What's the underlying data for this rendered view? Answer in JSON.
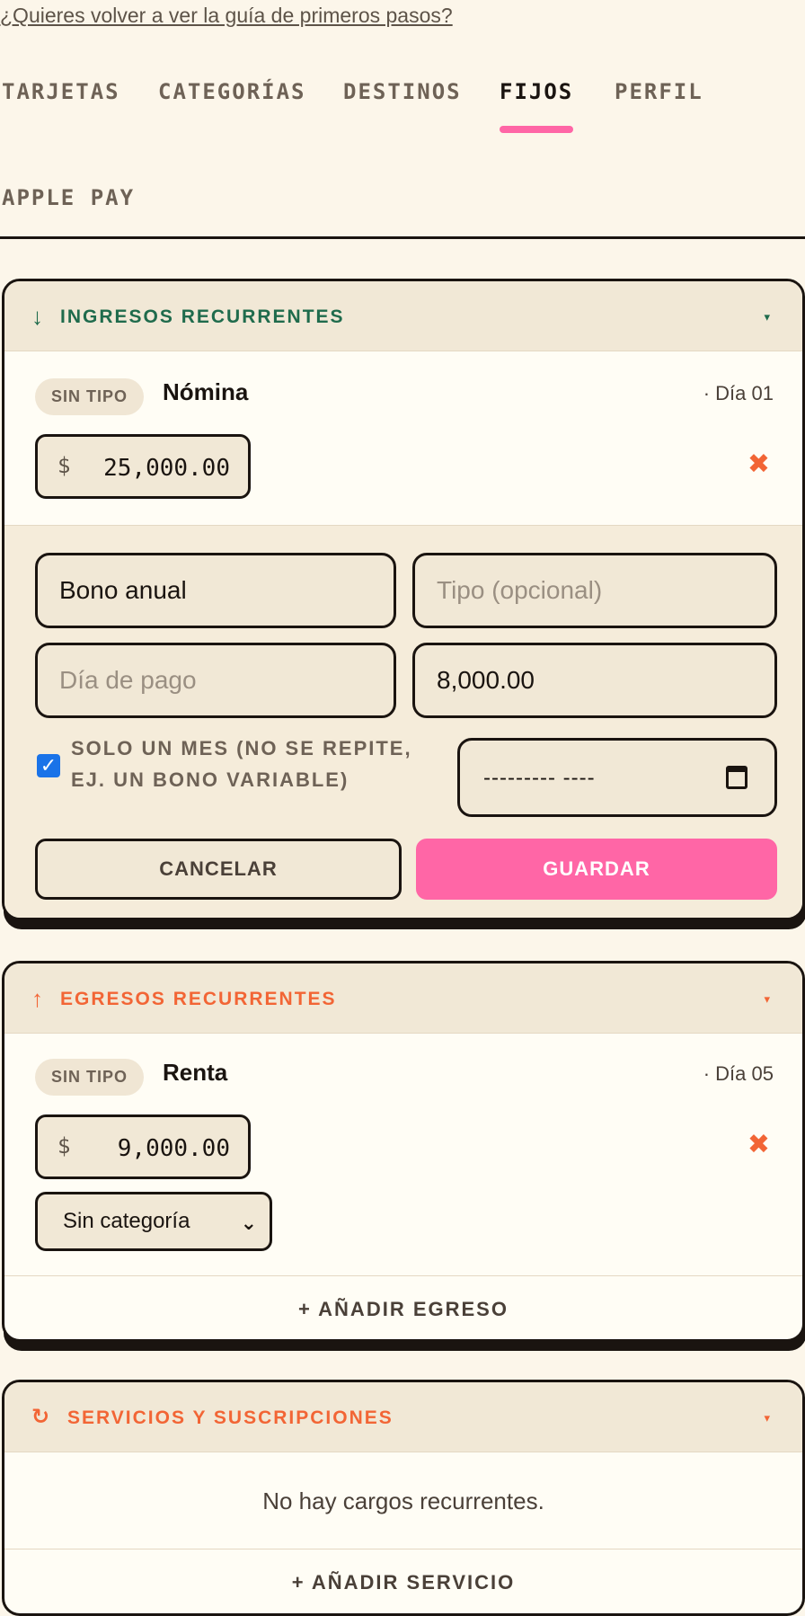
{
  "guide_link": "¿Quieres volver a ver la guía de primeros pasos?",
  "tabs": [
    {
      "label": "TARJETAS"
    },
    {
      "label": "CATEGORÍAS"
    },
    {
      "label": "DESTINOS"
    },
    {
      "label": "FIJOS",
      "active": true
    },
    {
      "label": "PERFIL"
    },
    {
      "label": "APPLE PAY"
    }
  ],
  "income": {
    "icon": "arrow-down-icon",
    "title": "INGRESOS RECURRENTES",
    "caret": "▾",
    "item": {
      "badge": "SIN TIPO",
      "name": "Nómina",
      "day": "· Día 01",
      "currency": "$",
      "amount": "25,000.00",
      "delete": "✖"
    },
    "form": {
      "name_value": "Bono anual",
      "type_placeholder": "Tipo (opcional)",
      "day_placeholder": "Día de pago",
      "amount_value": "8,000.00",
      "one_month_label": "SOLO UN MES (NO SE REPITE, EJ. UN BONO VARIABLE)",
      "one_month_checked": true,
      "date_value": "--------- ----",
      "cancel_label": "CANCELAR",
      "save_label": "GUARDAR"
    }
  },
  "expenses": {
    "icon": "arrow-up-icon",
    "title": "EGRESOS RECURRENTES",
    "caret": "▾",
    "item": {
      "badge": "SIN TIPO",
      "name": "Renta",
      "day": "· Día 05",
      "currency": "$",
      "amount": "9,000.00",
      "delete": "✖",
      "category": "Sin categoría"
    },
    "add_label": "+ AÑADIR EGRESO"
  },
  "services": {
    "icon": "refresh-icon",
    "title": "SERVICIOS Y SUSCRIPCIONES",
    "caret": "▾",
    "empty_text": "No hay cargos recurrentes.",
    "add_label": "+ AÑADIR SERVICIO"
  },
  "colors": {
    "accent_pink": "#ff66a6",
    "income_green": "#1f6b4c",
    "expense_orange": "#f26535",
    "background": "#fcf6ea"
  }
}
